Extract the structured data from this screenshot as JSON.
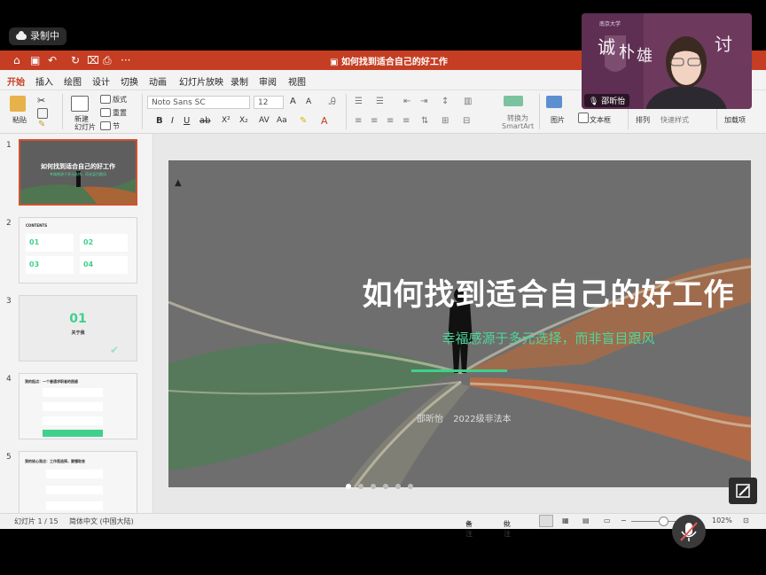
{
  "recording": {
    "label": "录制中"
  },
  "titlebar": {
    "title": "如何找到适合自己的好工作"
  },
  "tabs": [
    "开始",
    "插入",
    "绘图",
    "设计",
    "切换",
    "动画",
    "幻灯片放映",
    "录制",
    "审阅",
    "视图"
  ],
  "ribbon": {
    "paste": "粘贴",
    "new_slide": "新建\n幻灯片",
    "layout": "版式",
    "reset": "重置",
    "section": "节",
    "font": "Noto Sans SC",
    "size": "12",
    "convert_smartart": "转换为\nSmartArt",
    "picture": "图片",
    "textbox": "文本框",
    "arrange": "排列",
    "quick_styles": "快速样式",
    "addins": "加载项"
  },
  "thumbnails": [
    {
      "num": "1",
      "title": "如何找到适合自己的好工作",
      "sub": "幸福感源于多元选择，而非盲目跟风"
    },
    {
      "num": "2",
      "header": "CONTENTS",
      "items": [
        "01",
        "02",
        "03",
        "04"
      ]
    },
    {
      "num": "3",
      "big": "01",
      "label": "关于我"
    },
    {
      "num": "4",
      "header": "我的起点：一个普通求职者的困惑"
    },
    {
      "num": "5",
      "header": "我的核心观点：工作是选择，要懂取舍"
    }
  ],
  "slide": {
    "title": "如何找到适合自己的好工作",
    "subtitle": "幸福感源于多元选择，而非盲目跟风",
    "author": "邵昕怡",
    "class": "2022级非法本"
  },
  "status": {
    "slide_counter": "幻灯片 1 / 15",
    "language": "简体中文 (中国大陆)",
    "notes": "备注",
    "comments": "批注",
    "zoom": "102%"
  },
  "webcam": {
    "name": "邵昕怡"
  },
  "colors": {
    "accent": "#c53d22",
    "green": "#3fd08d"
  }
}
